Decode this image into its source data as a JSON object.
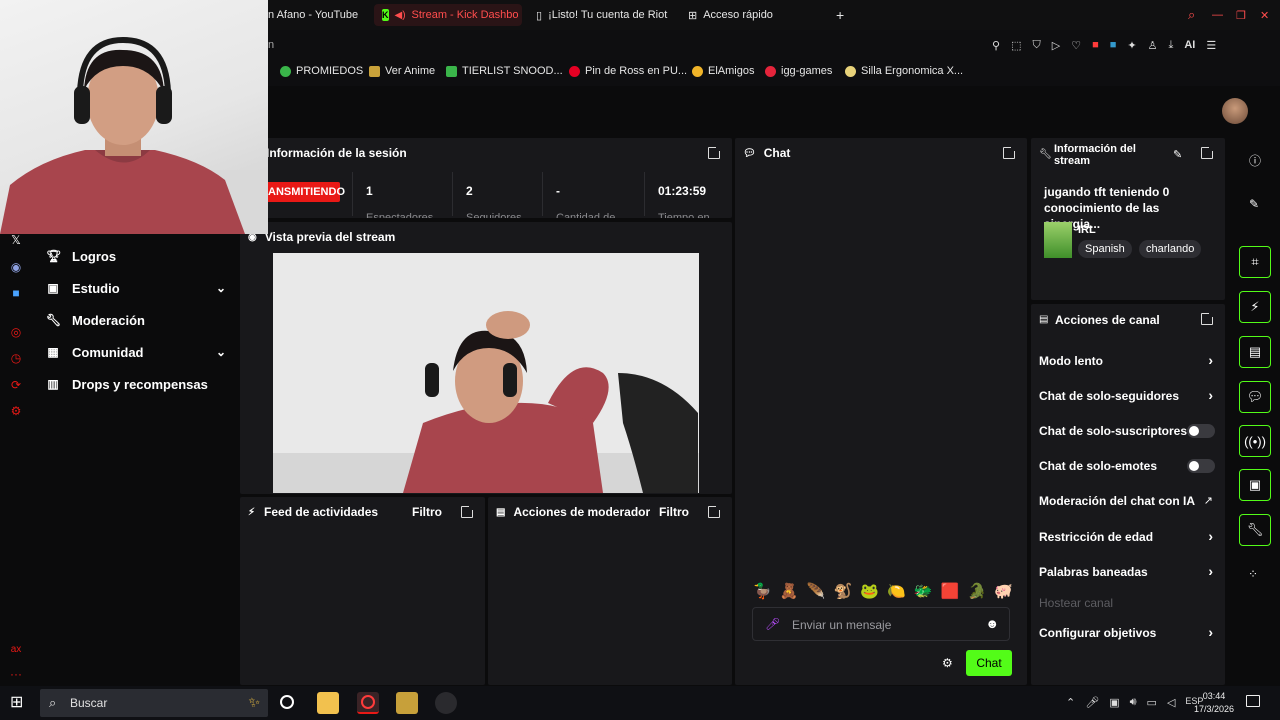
{
  "browser": {
    "tabs": [
      {
        "label": "n Afano - YouTube"
      },
      {
        "label": "Stream - Kick Dashbo"
      },
      {
        "label": "¡Listo! Tu cuenta de Riot y"
      },
      {
        "label": "Acceso rápido"
      }
    ],
    "address_fragment": "n",
    "ai_label": "AI",
    "bookmarks": [
      {
        "label": "PROMIEDOS",
        "color": "#3ab54a"
      },
      {
        "label": "Ver Anime",
        "color": "#c9a23a"
      },
      {
        "label": "TIERLIST SNOOD...",
        "color": "#3ab54a"
      },
      {
        "label": "Pin de Ross en PU...",
        "color": "#e60023"
      },
      {
        "label": "ElAmigos",
        "color": "#f0b429"
      },
      {
        "label": "igg-games",
        "color": "#e5243b"
      },
      {
        "label": "Silla Ergonomica X...",
        "color": "#e8d27a"
      }
    ]
  },
  "sidebar": {
    "items": [
      {
        "label": "Logros",
        "icon": "trophy-icon"
      },
      {
        "label": "Estudio",
        "icon": "studio-icon"
      },
      {
        "label": "Moderación",
        "icon": "wrench-icon"
      },
      {
        "label": "Comunidad",
        "icon": "community-icon"
      },
      {
        "label": "Drops y recompensas",
        "icon": "drops-icon"
      }
    ],
    "rail_footer": "ax"
  },
  "session": {
    "title": "Información de la sesión",
    "status_badge": "ANSMITIENDO",
    "stats": [
      {
        "value": "1",
        "label": "Espectadores"
      },
      {
        "value": "2",
        "label": "Seguidores"
      },
      {
        "value": "-",
        "label": "Cantidad de"
      },
      {
        "value": "01:23:59",
        "label": "Tiempo en"
      }
    ]
  },
  "preview": {
    "title": "Vista previa del stream"
  },
  "feed": {
    "title": "Feed de actividades",
    "filter": "Filtro"
  },
  "modactions": {
    "title": "Acciones de moderador",
    "filter": "Filtro"
  },
  "chat": {
    "title": "Chat",
    "placeholder": "Enviar un mensaje",
    "send_label": "Chat",
    "emotes": [
      "🦆",
      "🧸",
      "🪶",
      "🐒",
      "🐸",
      "🍋",
      "🐲",
      "🟥",
      "🐊",
      "🐖"
    ]
  },
  "stream_info": {
    "title": "Información del stream",
    "stream_title": "jugando tft teniendo 0 conocimiento de las sinergia...",
    "category": "IRL",
    "tags": [
      "Spanish",
      "charlando"
    ]
  },
  "channel_actions": {
    "title": "Acciones de canal",
    "items": [
      {
        "label": "Modo lento",
        "control": "chevron"
      },
      {
        "label": "Chat de solo-seguidores",
        "control": "chevron"
      },
      {
        "label": "Chat de solo-suscriptores",
        "control": "toggle",
        "enabled": false
      },
      {
        "label": "Chat de solo-emotes",
        "control": "toggle",
        "enabled": false
      },
      {
        "label": "Moderación del chat con IA",
        "control": "external"
      },
      {
        "label": "Restricción de edad",
        "control": "chevron"
      },
      {
        "label": "Palabras baneadas",
        "control": "chevron"
      },
      {
        "label": "Hostear canal",
        "control": "none",
        "disabled": true
      },
      {
        "label": "Configurar objetivos",
        "control": "chevron"
      }
    ]
  },
  "taskbar": {
    "search_label": "Buscar",
    "language": "ESP",
    "time": "03:44",
    "date": "17/3/2026"
  },
  "colors": {
    "accent": "#53fc18",
    "live": "#e91916",
    "panel": "#18181b"
  }
}
